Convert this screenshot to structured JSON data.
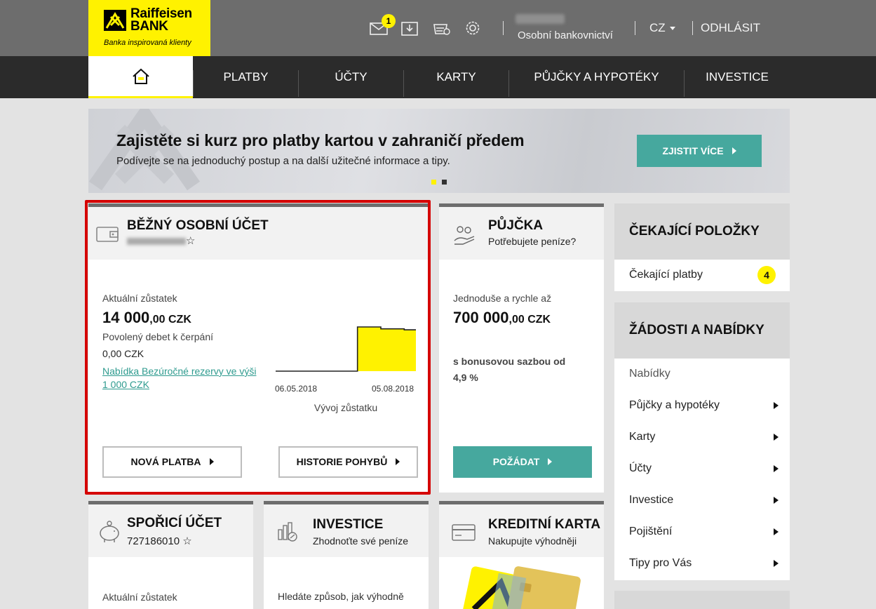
{
  "brand": {
    "name_line1": "Raiffeisen",
    "name_line2": "BANK",
    "tagline": "Banka inspirovaná klienty",
    "accent": "#fff200",
    "teal": "#46a89e"
  },
  "header": {
    "icons": [
      "mail-icon",
      "inbox-download-icon",
      "basket-settings-icon",
      "gear-icon"
    ],
    "mail_badge": "1",
    "section_label": "Osobní bankovnictví",
    "language": "CZ",
    "logout": "ODHLÁSIT"
  },
  "nav": {
    "items": [
      {
        "label": ""
      },
      {
        "label": "PLATBY"
      },
      {
        "label": "ÚČTY"
      },
      {
        "label": "KARTY"
      },
      {
        "label": "PŮJČKY A HYPOTÉKY"
      },
      {
        "label": "INVESTICE"
      }
    ]
  },
  "banner": {
    "title": "Zajistěte si kurz pro platby kartou v zahraničí předem",
    "subtitle": "Podívejte se na jednoduchý postup a na další užitečné informace a tipy.",
    "button": "ZJISTIT VÍCE"
  },
  "account": {
    "title": "BĚŽNÝ OSOBNÍ ÚČET",
    "star": "☆",
    "balance_label": "Aktuální zůstatek",
    "balance_main": "14 000",
    "balance_dec": ",00 CZK",
    "overdraft_label": "Povolený debet k čerpání",
    "overdraft_value": "0,00 CZK",
    "offer_link": "Nabídka Bezúročné rezervy ve výši 1 000 CZK",
    "btn_payment": "NOVÁ PLATBA",
    "btn_history": "HISTORIE POHYBŮ"
  },
  "chart_data": {
    "type": "area",
    "x": [
      "06.05.2018",
      "05.08.2018"
    ],
    "series": [
      {
        "values": [
          0,
          0,
          0,
          0,
          0,
          0,
          0,
          14000,
          14000,
          13400,
          13400,
          13100,
          13100
        ]
      }
    ],
    "xlabel": "Vývoj zůstatku",
    "color": "#fff200",
    "line_color": "#222222"
  },
  "loan": {
    "title": "PŮJČKA",
    "subtitle": "Potřebujete peníze?",
    "intro": "Jednoduše a rychle až",
    "amount_main": "700 000",
    "amount_dec": ",00 CZK",
    "bonus": "s bonusovou sazbou od",
    "rate": "4,9 %",
    "button": "POŽÁDAT"
  },
  "pending": {
    "title": "ČEKAJÍCÍ POLOŽKY",
    "item_label": "Čekající platby",
    "item_count": "4"
  },
  "offers": {
    "title": "ŽÁDOSTI A NABÍDKY",
    "section": "Nabídky",
    "items": [
      {
        "label": "Půjčky a hypotéky"
      },
      {
        "label": "Karty"
      },
      {
        "label": "Účty"
      },
      {
        "label": "Investice"
      },
      {
        "label": "Pojištění"
      },
      {
        "label": "Tipy pro Vás"
      }
    ]
  },
  "savings": {
    "title": "SPOŘICÍ ÚČET",
    "number": "727186010",
    "star": "☆",
    "balance_label": "Aktuální zůstatek"
  },
  "invest": {
    "title": "INVESTICE",
    "subtitle": "Zhodnoťte své peníze",
    "text": "Hledáte způsob, jak výhodně"
  },
  "credit": {
    "title": "KREDITNÍ KARTA",
    "subtitle": "Nakupujte výhodněji"
  }
}
